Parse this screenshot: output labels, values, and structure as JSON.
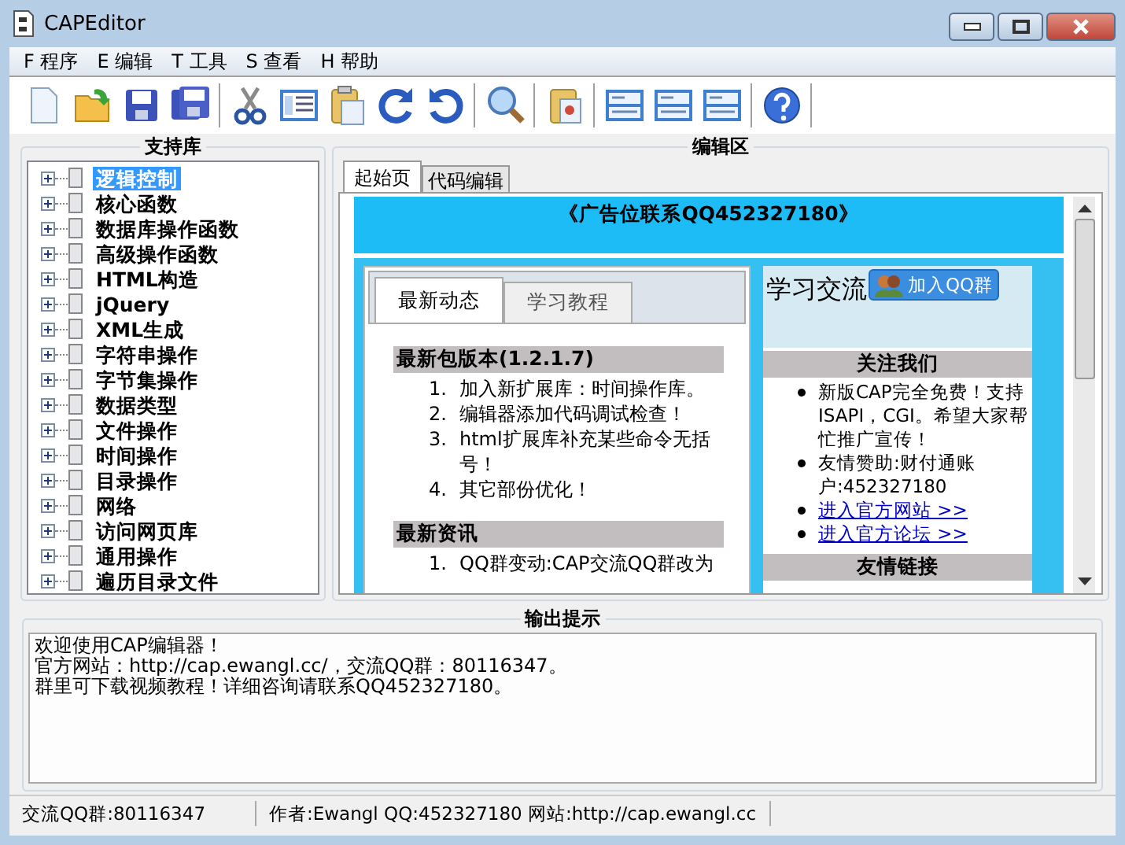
{
  "window": {
    "title": "CAPEditor"
  },
  "menu": [
    "F 程序",
    "E 编辑",
    "T 工具",
    "S 查看",
    "H 帮助"
  ],
  "library": {
    "title": "支持库",
    "items": [
      {
        "label": "逻辑控制",
        "selected": true
      },
      {
        "label": "核心函数",
        "selected": false
      },
      {
        "label": "数据库操作函数",
        "selected": false
      },
      {
        "label": "高级操作函数",
        "selected": false
      },
      {
        "label": "HTML构造",
        "selected": false
      },
      {
        "label": "jQuery",
        "selected": false
      },
      {
        "label": "XML生成",
        "selected": false
      },
      {
        "label": "字符串操作",
        "selected": false
      },
      {
        "label": "字节集操作",
        "selected": false
      },
      {
        "label": "数据类型",
        "selected": false
      },
      {
        "label": "文件操作",
        "selected": false
      },
      {
        "label": "时间操作",
        "selected": false
      },
      {
        "label": "目录操作",
        "selected": false
      },
      {
        "label": "网络",
        "selected": false
      },
      {
        "label": "访问网页库",
        "selected": false
      },
      {
        "label": "通用操作",
        "selected": false
      },
      {
        "label": "遍历目录文件",
        "selected": false
      }
    ]
  },
  "editor": {
    "title": "编辑区",
    "tabs": [
      {
        "label": "起始页",
        "selected": true
      },
      {
        "label": "代码编辑",
        "selected": false
      }
    ],
    "page": {
      "banner": "《广告位联系QQ452327180》",
      "tabs": [
        {
          "label": "最新动态",
          "selected": true
        },
        {
          "label": "学习教程",
          "selected": false
        }
      ],
      "sections": [
        {
          "heading": "最新包版本(1.2.1.7)",
          "items": [
            {
              "number": "1.",
              "text": "加入新扩展库：时间操作库。"
            },
            {
              "number": "2.",
              "text": "编辑器添加代码调试检查！"
            },
            {
              "number": "3.",
              "text": "html扩展库补充某些命令无括号！"
            },
            {
              "number": "4.",
              "text": "其它部份优化！"
            }
          ]
        },
        {
          "heading": "最新资讯",
          "items": [
            {
              "number": "1.",
              "text": "QQ群变动:CAP交流QQ群改为"
            }
          ]
        }
      ],
      "side_title": "学习交流",
      "join_button": "加入QQ群",
      "follow_heading": "关注我们",
      "follow_items": [
        {
          "text": "新版CAP完全免费！支持ISAPI，CGI。希望大家帮忙推广宣传！",
          "kind": "text"
        },
        {
          "text": "友情赞助:财付通账户:452327180",
          "kind": "text"
        },
        {
          "text": "进入官方网站 >>",
          "kind": "link"
        },
        {
          "text": "进入官方论坛 >>",
          "kind": "link"
        }
      ],
      "links_heading": "友情链接"
    }
  },
  "output": {
    "title": "输出提示",
    "lines": [
      "欢迎使用CAP编辑器！",
      "官方网站：http://cap.ewangl.cc/，交流QQ群：80116347。",
      "群里可下载视频教程！详细咨询请联系QQ452327180。"
    ]
  },
  "status_bar": [
    "交流QQ群:80116347",
    "作者:Ewangl QQ:452327180 网站:http://cap.ewangl.cc"
  ]
}
